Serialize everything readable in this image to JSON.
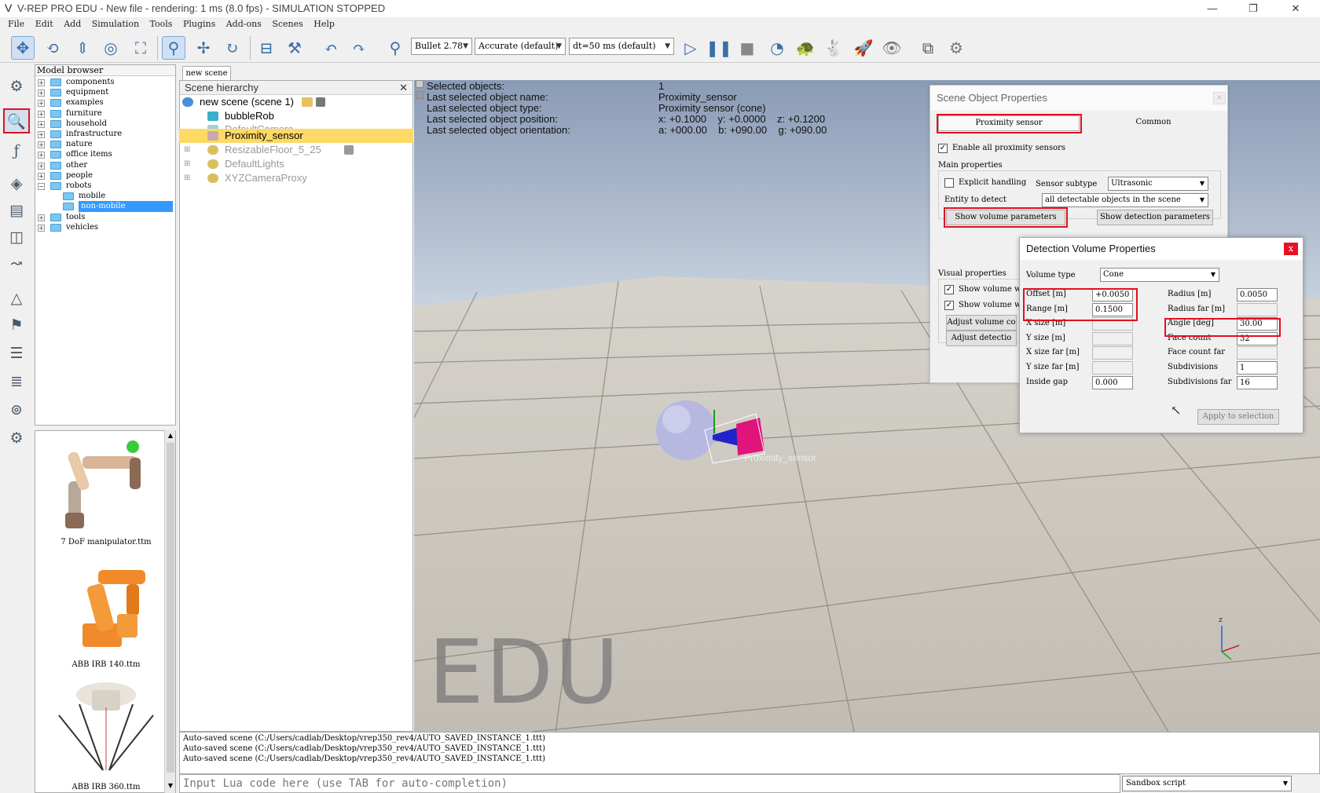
{
  "window": {
    "title": "V-REP PRO EDU - New file - rendering: 1 ms (8.0 fps) - SIMULATION STOPPED",
    "min": "—",
    "max": "❐",
    "close": "✕"
  },
  "menu": [
    "File",
    "Edit",
    "Add",
    "Simulation",
    "Tools",
    "Plugins",
    "Add-ons",
    "Scenes",
    "Help"
  ],
  "toolbar": {
    "engine": "Bullet 2.78",
    "accuracy": "Accurate (default)",
    "timestep": "dt=50 ms (default)"
  },
  "model_browser": {
    "header": "Model browser",
    "items": [
      "components",
      "equipment",
      "examples",
      "furniture",
      "household",
      "infrastructure",
      "nature",
      "office items",
      "other",
      "people",
      "robots",
      "mobile",
      "non-mobile",
      "tools",
      "vehicles"
    ],
    "thumbs": [
      "7 DoF manipulator.ttm",
      "ABB IRB 140.ttm",
      "ABB IRB 360.ttm"
    ]
  },
  "scene_tab": "new scene",
  "hierarchy": {
    "header": "Scene hierarchy",
    "close": "✕",
    "items": [
      "new scene (scene 1)",
      "bubbleRob",
      "DefaultCamera",
      "Proximity_sensor",
      "ResizableFloor_5_25",
      "DefaultLights",
      "XYZCameraProxy"
    ]
  },
  "info": {
    "labels": [
      "Selected objects:",
      "Last selected object name:",
      "Last selected object type:",
      "Last selected object position:",
      "Last selected object orientation:"
    ],
    "values": [
      "1",
      "Proximity_sensor",
      "Proximity sensor (cone)",
      "x: +0.1000    y: +0.0000    z: +0.1200",
      "a: +000.00    b: +090.00    g: +090.00"
    ]
  },
  "viewport_label": "Proximity_sensor",
  "watermark": "EDU",
  "sop": {
    "title": "Scene Object Properties",
    "tab1": "Proximity sensor",
    "tab2": "Common",
    "enable_all": "Enable all proximity sensors",
    "main_props": "Main properties",
    "explicit": "Explicit handling",
    "subtype_label": "Sensor subtype",
    "subtype": "Ultrasonic",
    "entity_label": "Entity to detect",
    "entity": "all detectable objects in the scene",
    "show_volume": "Show volume parameters",
    "show_detection": "Show detection parameters",
    "visual_props": "Visual properties",
    "show_vol1": "Show volume whe",
    "show_vol2": "Show volume whe",
    "adjust_vol": "Adjust volume co",
    "adjust_det": "Adjust detectio"
  },
  "dvp": {
    "title": "Detection Volume Properties",
    "close": "x",
    "volume_type_label": "Volume type",
    "volume_type": "Cone",
    "left_labels": [
      "Offset [m]",
      "Range [m]",
      "X size [m]",
      "Y size [m]",
      "X size far [m]",
      "Y size far [m]",
      "Inside gap"
    ],
    "left_values": [
      "+0.0050",
      "0.1500",
      "",
      "",
      "",
      "",
      "0.000"
    ],
    "right_labels": [
      "Radius [m]",
      "Radius far [m]",
      "Angle [deg]",
      "Face count",
      "Face count far",
      "Subdivisions",
      "Subdivisions far"
    ],
    "right_values": [
      "0.0050",
      "",
      "30.00",
      "32",
      "",
      "1",
      "16"
    ],
    "apply": "Apply to selection"
  },
  "console": [
    "Auto-saved scene (C:/Users/cadlab/Desktop/vrep350_rev4/AUTO_SAVED_INSTANCE_1.ttt)",
    "Auto-saved scene (C:/Users/cadlab/Desktop/vrep350_rev4/AUTO_SAVED_INSTANCE_1.ttt)",
    "Auto-saved scene (C:/Users/cadlab/Desktop/vrep350_rev4/AUTO_SAVED_INSTANCE_1.ttt)"
  ],
  "lua_placeholder": "Input Lua code here (use TAB for auto-completion)",
  "sandbox": "Sandbox script"
}
